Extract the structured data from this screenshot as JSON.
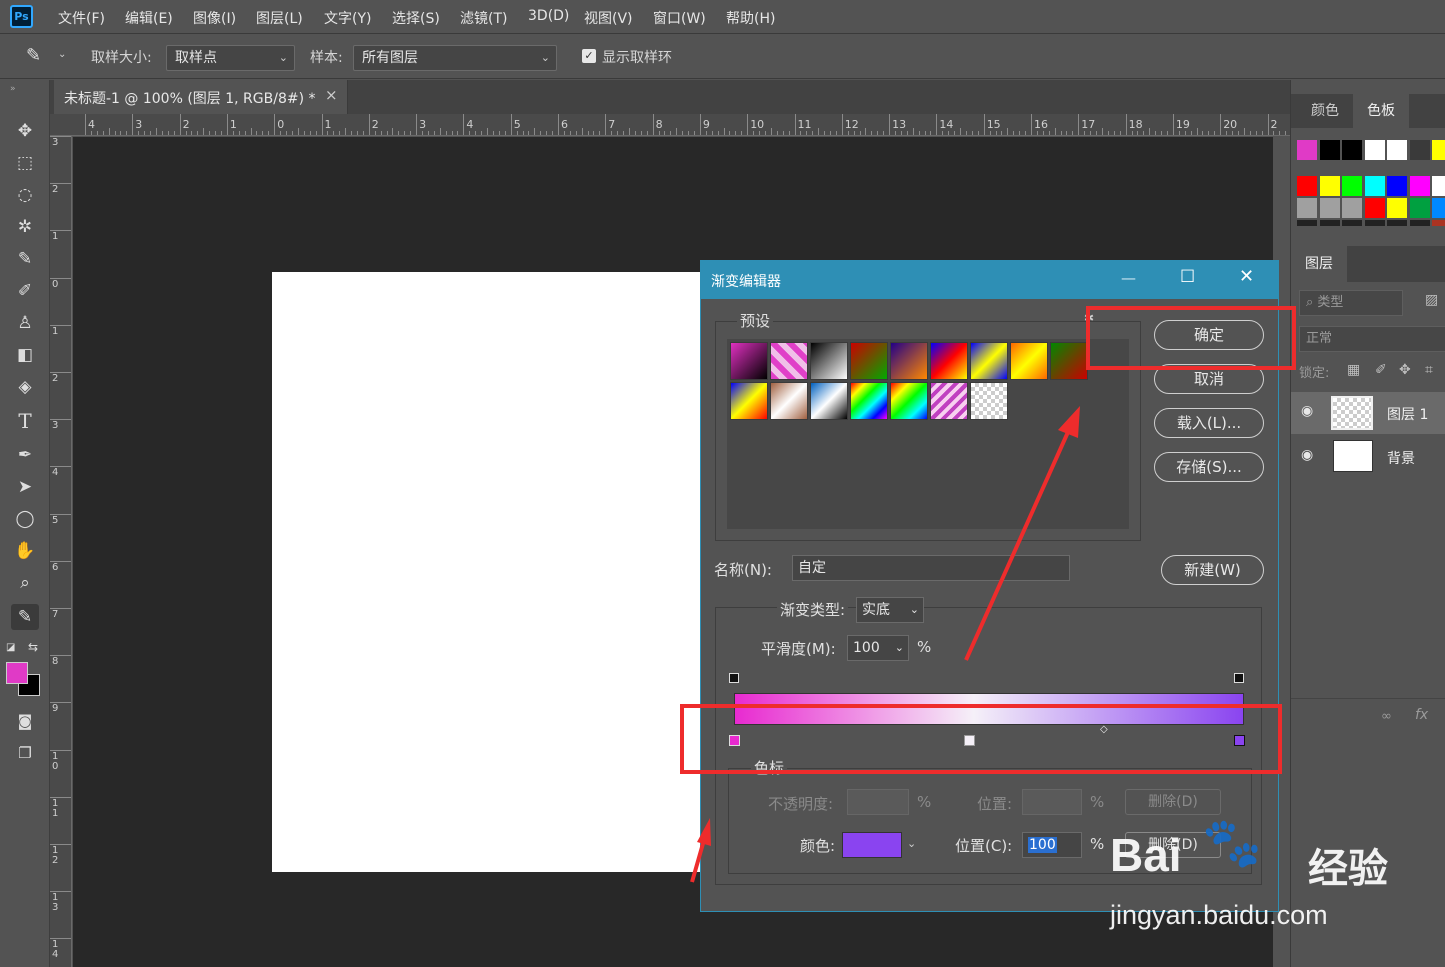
{
  "app": {
    "logo": "Ps"
  },
  "menu": [
    "文件(F)",
    "编辑(E)",
    "图像(I)",
    "图层(L)",
    "文字(Y)",
    "选择(S)",
    "滤镜(T)",
    "3D(D)",
    "视图(V)",
    "窗口(W)",
    "帮助(H)"
  ],
  "options": {
    "sample_size_label": "取样大小:",
    "sample_size_value": "取样点",
    "sample_label": "样本:",
    "sample_value": "所有图层",
    "show_ring_label": "显示取样环"
  },
  "document": {
    "tab_title": "未标题-1 @ 100% (图层 1, RGB/8#) *",
    "close": "×"
  },
  "ruler": {
    "h_ticks": [
      "4",
      "3",
      "2",
      "1",
      "0",
      "1",
      "2",
      "3",
      "4",
      "5",
      "6",
      "7",
      "8",
      "9",
      "10",
      "11",
      "12",
      "13",
      "14",
      "15",
      "16",
      "17",
      "18",
      "19",
      "20",
      "2"
    ],
    "v_ticks": [
      "3",
      "2",
      "1",
      "0",
      "1",
      "2",
      "3",
      "4",
      "5",
      "6",
      "7",
      "8",
      "9",
      "10",
      "11",
      "12",
      "13",
      "14"
    ]
  },
  "panels": {
    "color_tab": "颜色",
    "swatches_tab": "色板",
    "layers_tab": "图层",
    "filter_label": "类型",
    "blend_mode": "正常",
    "lock_label": "锁定:",
    "layers": [
      {
        "name": "图层 1"
      },
      {
        "name": "背景"
      }
    ],
    "fx_label": "fx"
  },
  "dialog": {
    "title": "渐变编辑器",
    "presets_label": "预设",
    "ok": "确定",
    "cancel": "取消",
    "load": "载入(L)...",
    "save": "存储(S)...",
    "name_label": "名称(N):",
    "name_value": "自定",
    "new_button": "新建(W)",
    "gradient_type_label": "渐变类型:",
    "gradient_type_value": "实底",
    "smoothness_label": "平滑度(M):",
    "smoothness_value": "100",
    "percent": "%",
    "stops_label": "色标",
    "opacity_label": "不透明度:",
    "location_label_disabled": "位置:",
    "delete_label": "删除(D)",
    "color_label": "颜色:",
    "location_label": "位置(C):",
    "location_value": "100",
    "gradient_start": "#e82ad0",
    "gradient_mid": "#f5f0f8",
    "gradient_end": "#8a44f0",
    "stop_color": "#8a44f0"
  },
  "colors": {
    "foreground": "#e03ac6",
    "background": "#000000",
    "accent": "#2e8fb5",
    "annotation": "#ee2c2c"
  },
  "watermark": {
    "brand": "Bai",
    "brand_cn": "经验",
    "url": "jingyan.baidu.com"
  }
}
